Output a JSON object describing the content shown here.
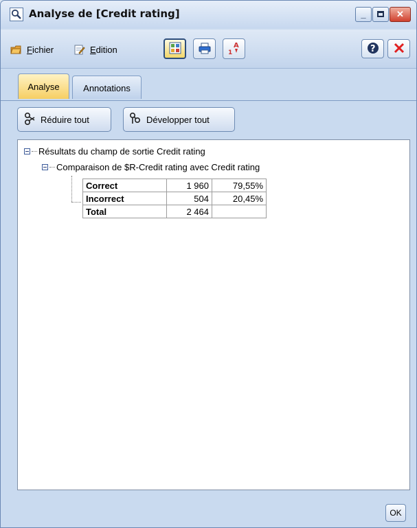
{
  "window": {
    "title": "Analyse de [Credit rating]",
    "controls": [
      "minimize",
      "maximize",
      "close"
    ]
  },
  "toolbar": {
    "file_label": "Fichier",
    "file_accel": "F",
    "file_rest": "ichier",
    "edit_label": "Edition",
    "edit_accel": "E",
    "edit_rest": "dition",
    "icons": [
      "generate-icon",
      "print-icon",
      "sort-icon",
      "help-icon",
      "close-icon"
    ]
  },
  "tabs": [
    {
      "label": "Analyse",
      "active": true
    },
    {
      "label": "Annotations",
      "active": false
    }
  ],
  "actions": {
    "collapse_label": "Réduire tout",
    "expand_label": "Développer tout"
  },
  "tree": {
    "root_label": "Résultats du champ de sortie Credit rating",
    "child_label": "Comparaison de $R-Credit rating avec Credit rating",
    "rows": [
      {
        "label": "Correct",
        "count": "1 960",
        "pct": "79,55%"
      },
      {
        "label": "Incorrect",
        "count": "504",
        "pct": "20,45%"
      },
      {
        "label": "Total",
        "count": "2 464",
        "pct": ""
      }
    ]
  },
  "footer": {
    "ok_label": "OK"
  },
  "colors": {
    "window_bg": "#c9daef",
    "active_tab": "#f6cf63",
    "close_red": "#d0412e"
  }
}
